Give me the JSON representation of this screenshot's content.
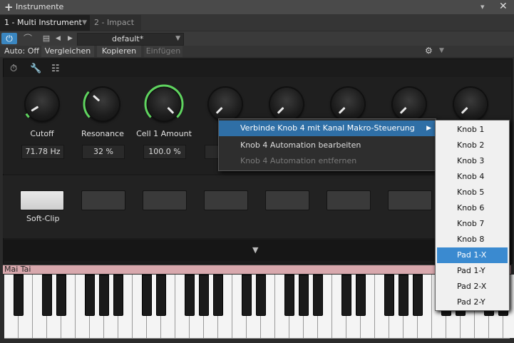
{
  "window": {
    "title": "Instrumente"
  },
  "tabs": [
    {
      "label": "1 - Multi Instrument",
      "active": true
    },
    {
      "label": "2 - Impact",
      "active": false
    }
  ],
  "toolbar": {
    "preset": "default*",
    "auto": "Auto: Off",
    "compare": "Vergleichen",
    "copy": "Kopieren",
    "paste": "Einfügen"
  },
  "knobs": [
    {
      "label": "Cutoff",
      "value": "71.78 Hz",
      "level": 0.05
    },
    {
      "label": "Resonance",
      "value": "32 %",
      "level": 0.32
    },
    {
      "label": "Cell 1 Amount",
      "value": "100.0 %",
      "level": 1.0
    },
    {
      "label": "",
      "value": "",
      "level": 0
    },
    {
      "label": "",
      "value": "",
      "level": 0
    },
    {
      "label": "",
      "value": "",
      "level": 0
    },
    {
      "label": "",
      "value": "",
      "level": 0
    },
    {
      "label": "",
      "value": "",
      "level": 0
    }
  ],
  "pads": {
    "first_label": "Soft-Clip"
  },
  "keyboard": {
    "instrument": "Mai Tai"
  },
  "context_menu": {
    "items": [
      {
        "label": "Verbinde Knob 4 mit Kanal Makro-Steuerung",
        "enabled": true,
        "highlighted": true,
        "has_submenu": true
      },
      {
        "label": "Knob 4 Automation bearbeiten",
        "enabled": true
      },
      {
        "label": "Knob 4 Automation entfernen",
        "enabled": false
      }
    ],
    "submenu": [
      {
        "label": "Knob 1"
      },
      {
        "label": "Knob 2"
      },
      {
        "label": "Knob 3"
      },
      {
        "label": "Knob 4"
      },
      {
        "label": "Knob 5"
      },
      {
        "label": "Knob 6"
      },
      {
        "label": "Knob 7"
      },
      {
        "label": "Knob 8"
      },
      {
        "label": "Pad 1-X",
        "selected": true
      },
      {
        "label": "Pad 1-Y"
      },
      {
        "label": "Pad 2-X"
      },
      {
        "label": "Pad 2-Y"
      }
    ]
  },
  "colors": {
    "accent": "#3a86c0",
    "knob_ring": "#5fd45f",
    "menu_highlight": "#2f6fa6",
    "submenu_highlight": "#3a8ad0",
    "keyboard_header": "#d8a8ad"
  }
}
